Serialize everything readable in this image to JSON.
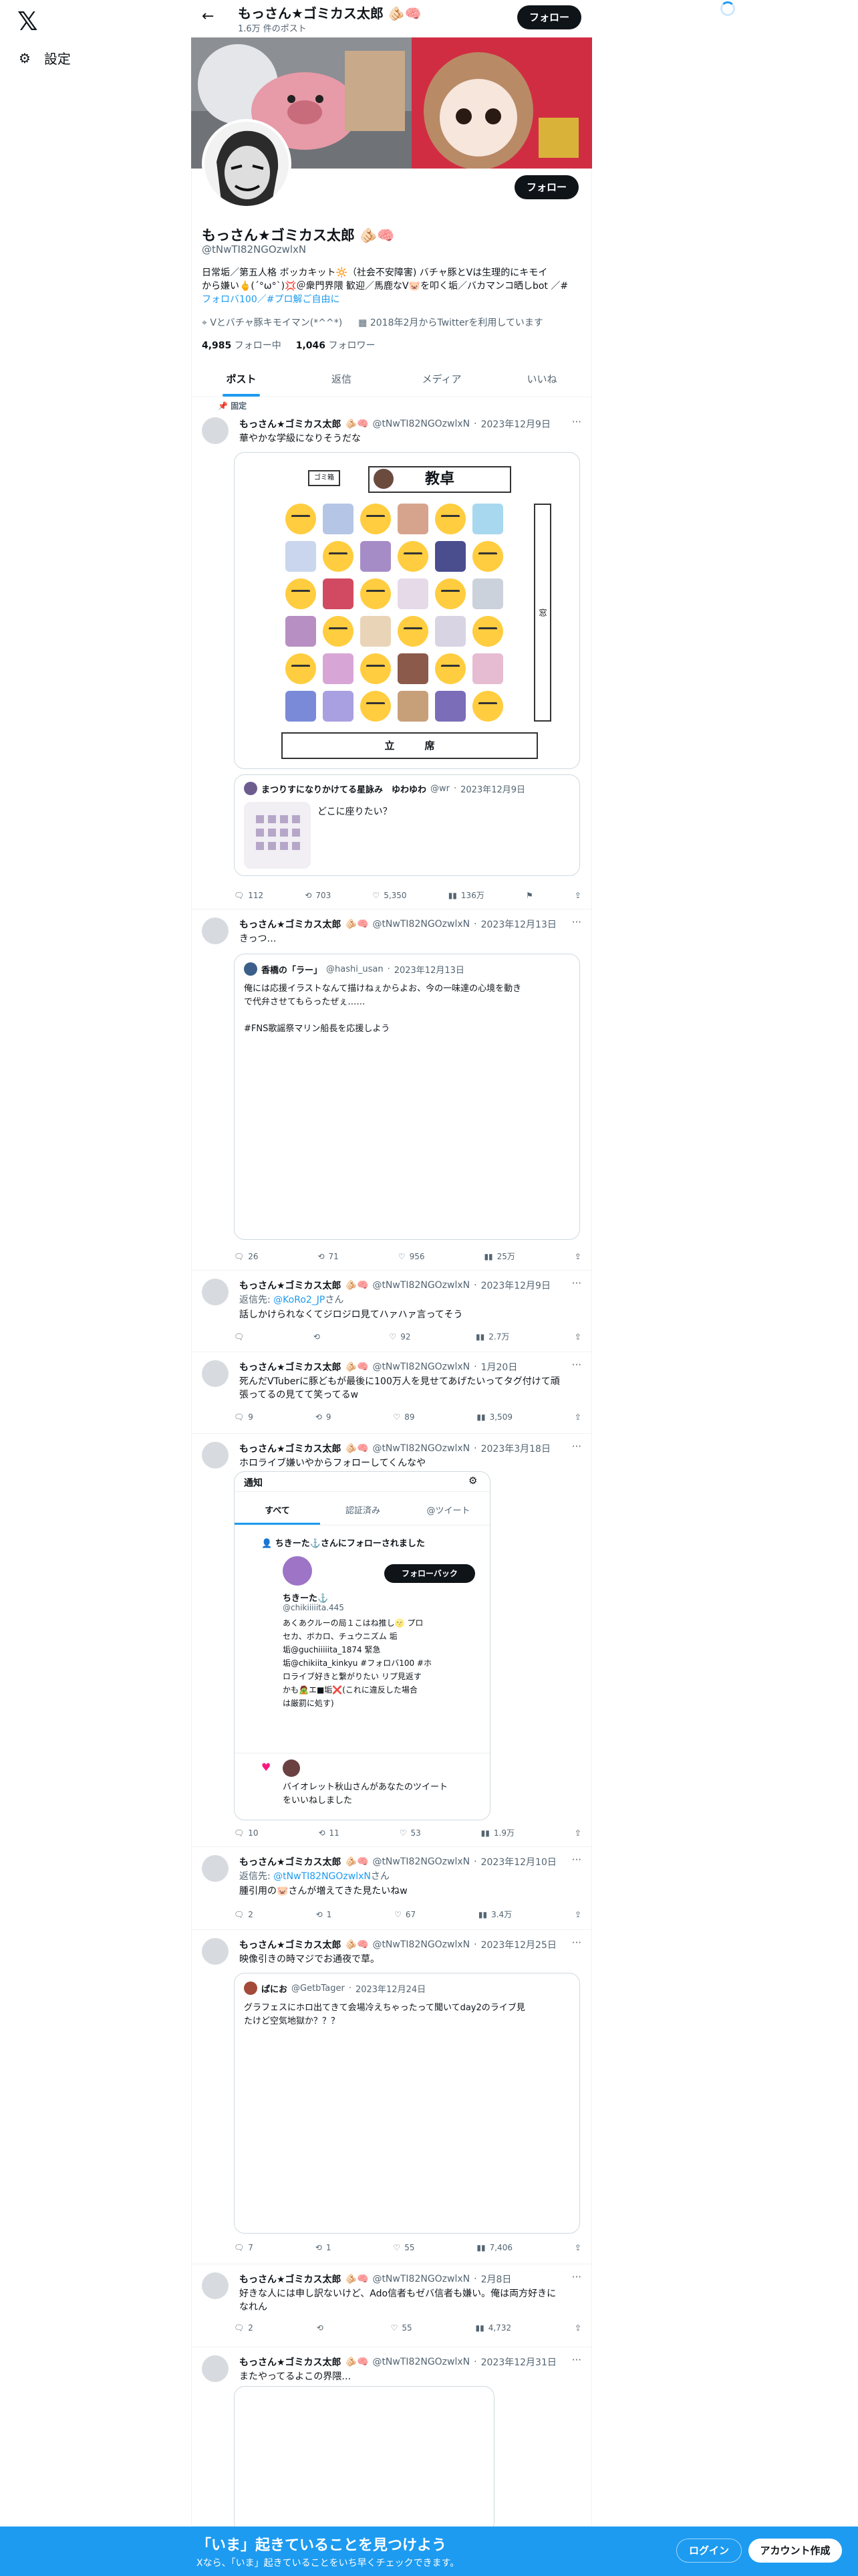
{
  "nav": {
    "logo": "𝕏",
    "settings": "設定"
  },
  "header": {
    "name": "もっさん★ゴミカス太郎",
    "posts_count": "1.6万 件のポスト",
    "follow": "フォロー"
  },
  "profile": {
    "name": "もっさん★ゴミカス太郎",
    "handle": "@tNwTI82NGOzwlxN",
    "follow": "フォロー",
    "bio_1": "日常垢／第五人格 ボッカキット🔆（社会不安障害) バチャ豚とVは生理的にキモイ",
    "bio_2": "から嫌い🖕(´°ω°`)💢＠衆門界隈 歓迎／馬鹿なV🐷を叩く垢／バカマンコ晒しbot ／#",
    "bio_3": "フォロバ100／#プロ解ご自由に",
    "location": "Vとバチャ豚キモイマン(*^^*)",
    "joined": "2018年2月からTwitterを利用しています",
    "following_count": "4,985",
    "following_label": "フォロー中",
    "followers_count": "1,046",
    "followers_label": "フォロワー"
  },
  "tabs": [
    "ポスト",
    "返信",
    "メディア",
    "いいね"
  ],
  "pinned_label": "固定",
  "tweets": [
    {
      "name": "もっさん★ゴミカス太郎",
      "handle": "@tNwTI82NGOzwlxN",
      "date": "2023年12月9日",
      "text": "華やかな学級になりそうだな",
      "seat": {
        "tag": "ゴミ箱",
        "title": "教卓",
        "side": "窓",
        "bottom": "立　　　席"
      },
      "quote": {
        "name": "まつりすになりかけてる星詠み　ゆわゆわ",
        "handle": "@wr",
        "date": "2023年12月9日",
        "text": "どこに座りたい？"
      },
      "stats": {
        "replies": "112",
        "retweets": "703",
        "likes": "5,350",
        "views": "136万"
      }
    },
    {
      "name": "もっさん★ゴミカス太郎",
      "handle": "@tNwTI82NGOzwlxN",
      "date": "2023年12月13日",
      "text": "きっつ…",
      "quote": {
        "name": "香橋の「ラー」",
        "handle": "@hashi_usan",
        "date": "2023年12月13日",
        "text_1": "俺には応援イラストなんて描けねぇからよお、今の一味達の心境を動き",
        "text_2": "で代弁させてもらったぜぇ……",
        "text_3": "#FNS歌謡祭マリン船長を応援しよう"
      },
      "stats": {
        "replies": "26",
        "retweets": "71",
        "likes": "956",
        "views": "25万"
      }
    },
    {
      "name": "もっさん★ゴミカス太郎",
      "handle": "@tNwTI82NGOzwlxN",
      "date": "2023年12月9日",
      "reply_to_label": "返信先:",
      "reply_to": "@KoRo2_JP",
      "reply_suffix": "さん",
      "text": "話しかけられなくてジロジロ見てハァハァ言ってそう",
      "stats": {
        "replies": "",
        "retweets": "",
        "likes": "92",
        "views": "2.7万"
      }
    },
    {
      "name": "もっさん★ゴミカス太郎",
      "handle": "@tNwTI82NGOzwlxN",
      "date": "1月20日",
      "text_1": "死んだVTuberに豚どもが最後に100万人を見せてあげたいってタグ付けて頑",
      "text_2": "張ってるの見てて笑ってるw",
      "stats": {
        "replies": "9",
        "retweets": "9",
        "likes": "89",
        "views": "3,509"
      }
    },
    {
      "name": "もっさん★ゴミカス太郎",
      "handle": "@tNwTI82NGOzwlxN",
      "date": "2023年3月18日",
      "text": "ホロライブ嫌いやからフォローしてくんなや",
      "notif": {
        "title": "通知",
        "tab_all": "すべて",
        "tab_verified": "認証済み",
        "tab_mention": "@ツイート",
        "follow_line": "ちきーた⚓️さんにフォローされました",
        "follow_back": "フォローバック",
        "user_name": "ちきーた⚓️",
        "user_handle": "@chikiiiiita.445",
        "bio_1": "あくあクルーの局１こはね推し🌝 プロ",
        "bio_2": "セカ、ボカロ、チュウニズム 垢",
        "bio_3": "垢@guchiiiiita_1874 緊急",
        "bio_4": "垢@chikiita_kinkyu #フォロバ100 #ホ",
        "bio_5": "ロライブ好きと繋がりたい リプ見返す",
        "bio_6": "かも🧟エ■垢❌(これに違反した場合",
        "bio_7": "は厳罰に処す)",
        "like_line_1": "バイオレット秋山さんがあなたのツイート",
        "like_line_2": "をいいねしました"
      },
      "stats": {
        "replies": "10",
        "retweets": "11",
        "likes": "53",
        "views": "1.9万"
      }
    },
    {
      "name": "もっさん★ゴミカス太郎",
      "handle": "@tNwTI82NGOzwlxN",
      "date": "2023年12月10日",
      "reply_to_label": "返信先:",
      "reply_to": "@tNwTI82NGOzwlxN",
      "reply_suffix": "さん",
      "text": "腫引用の🐷さんが増えてきた見たいねw",
      "stats": {
        "replies": "2",
        "retweets": "1",
        "likes": "67",
        "views": "3.4万"
      }
    },
    {
      "name": "もっさん★ゴミカス太郎",
      "handle": "@tNwTI82NGOzwlxN",
      "date": "2023年12月25日",
      "text": "映像引きの時マジでお通夜で草。",
      "quote": {
        "name": "ぱにお",
        "handle": "@GetbTager",
        "date": "2023年12月24日",
        "text_1": "グラフェスにホロ出てきて会場冷えちゃったって聞いてday2のライブ見",
        "text_2": "たけど空気地獄か？？？"
      },
      "stats": {
        "replies": "7",
        "retweets": "1",
        "likes": "55",
        "views": "7,406"
      }
    },
    {
      "name": "もっさん★ゴミカス太郎",
      "handle": "@tNwTI82NGOzwlxN",
      "date": "2月8日",
      "text_1": "好きな人には申し訳ないけど、Ado信者もゼバ信者も嫌い。俺は両方好きに",
      "text_2": "なれん",
      "stats": {
        "replies": "2",
        "retweets": "",
        "likes": "55",
        "views": "4,732"
      }
    },
    {
      "name": "もっさん★ゴミカス太郎",
      "handle": "@tNwTI82NGOzwlxN",
      "date": "2023年12月31日",
      "text": "またやってるよこの界隈…"
    }
  ],
  "bottom": {
    "title": "「いま」起きていることを見つけよう",
    "subtitle": "Xなら、「いま」起きていることをいち早くチェックできます。",
    "login": "ログイン",
    "signup": "アカウント作成"
  },
  "colors": {
    "accent": "#1d9bf0",
    "text": "#0f1419",
    "muted": "#536471"
  }
}
